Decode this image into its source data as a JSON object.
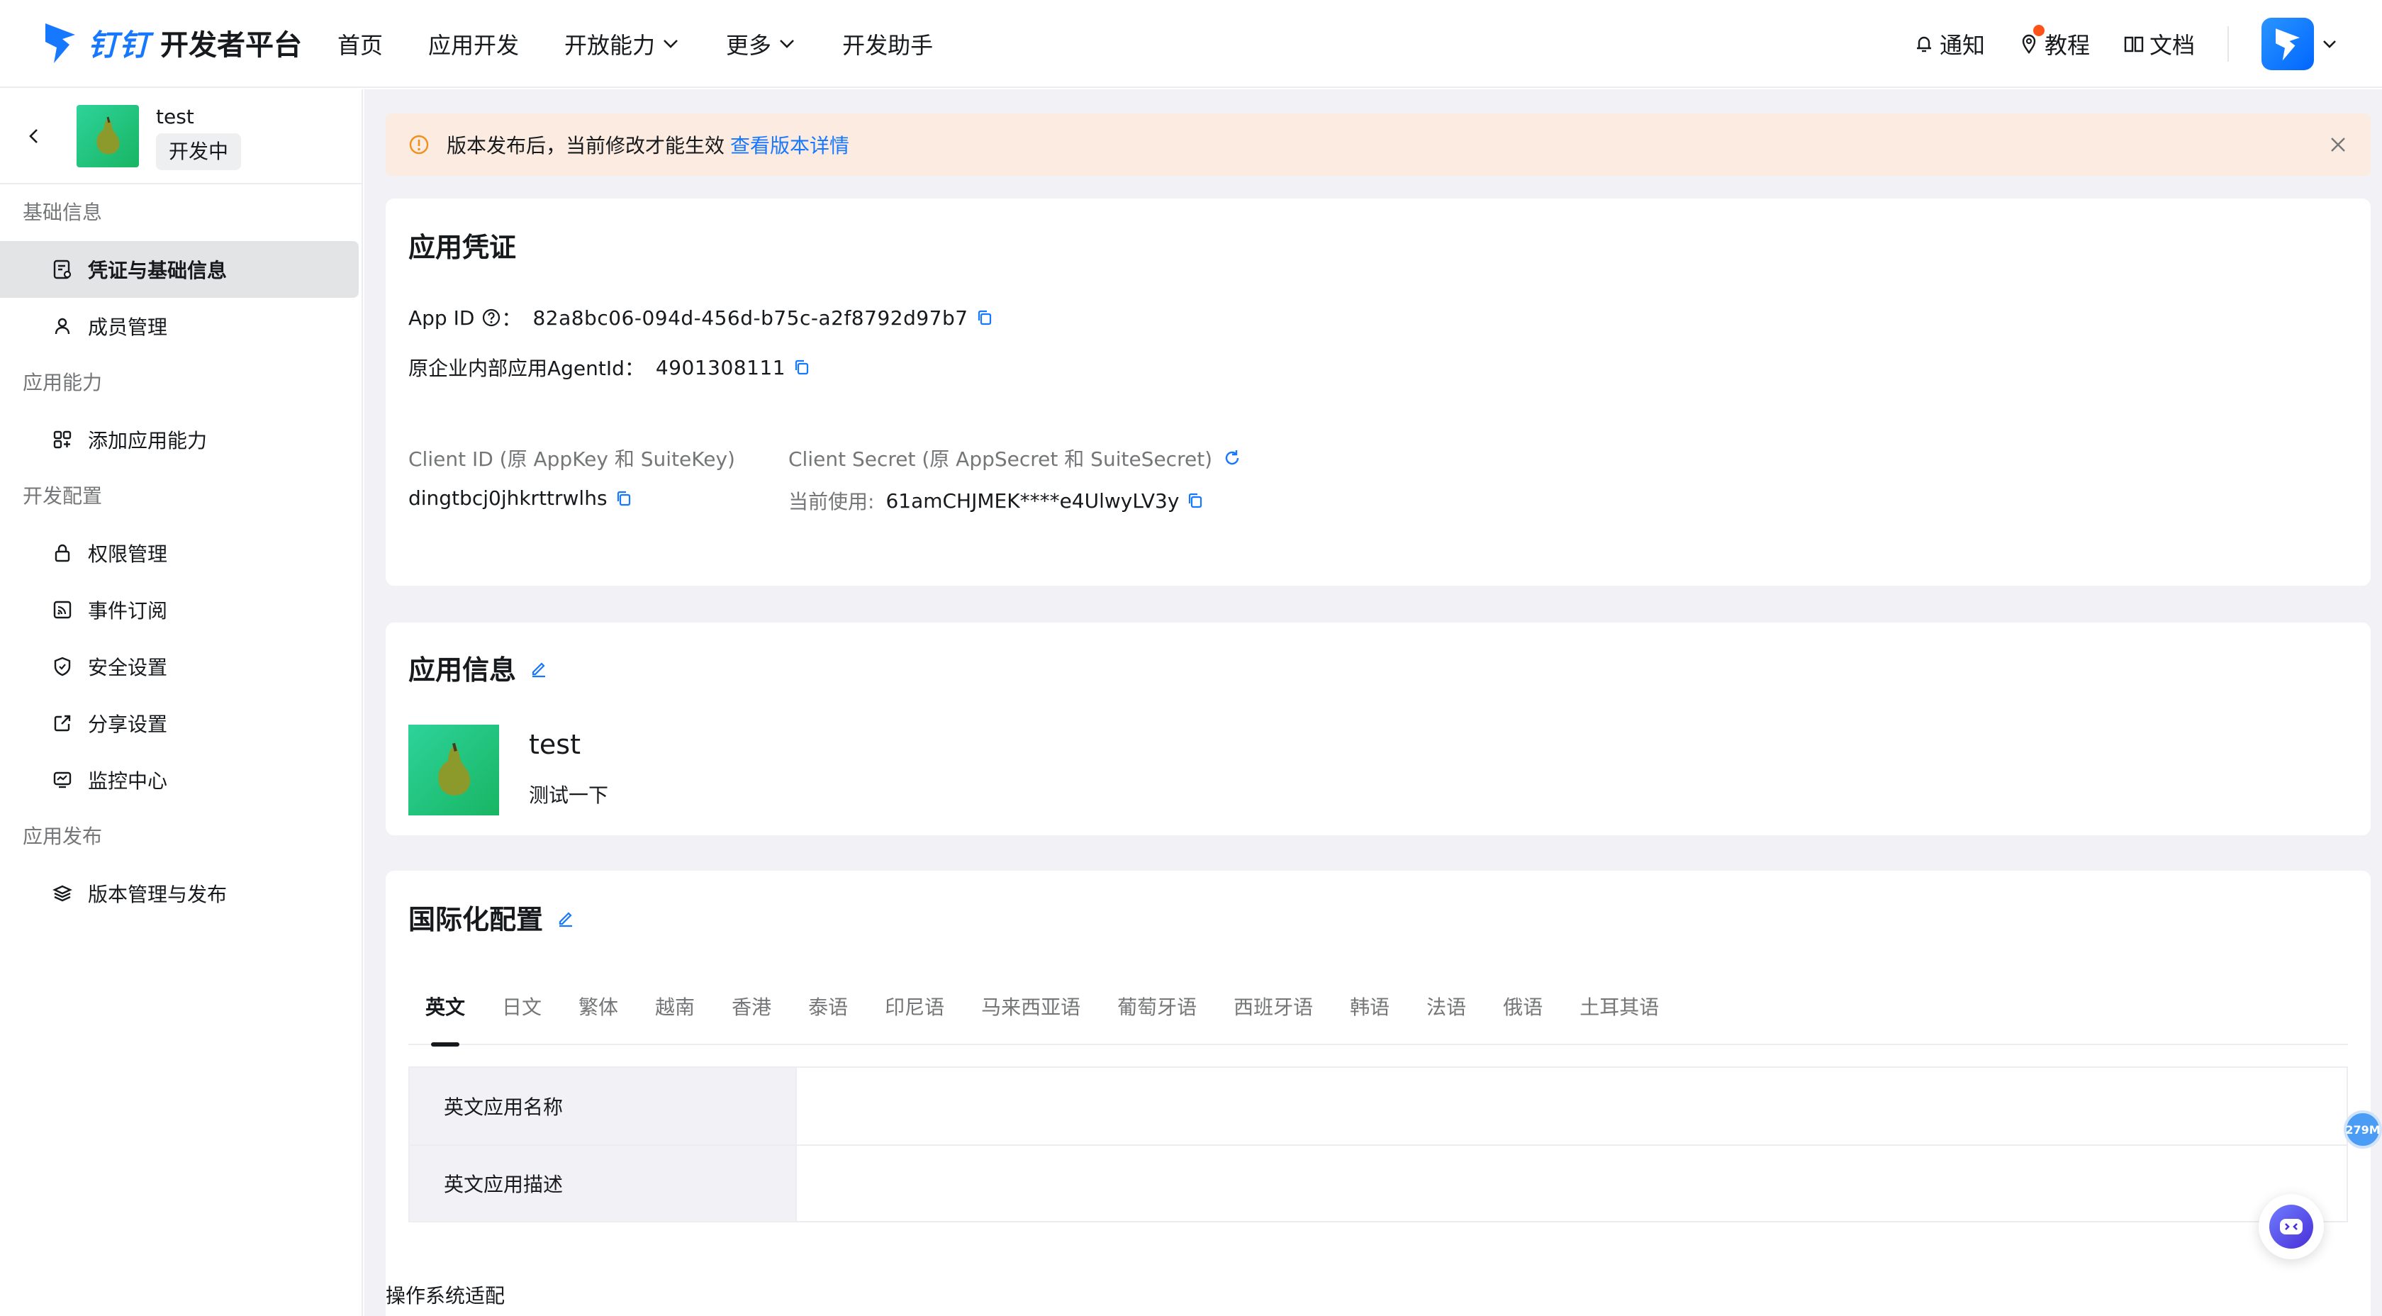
{
  "brand": {
    "logo_text": "钉钉",
    "subtitle": "开发者平台",
    "accent": "#1677ff"
  },
  "nav": {
    "items": [
      {
        "label": "首页",
        "dropdown": false
      },
      {
        "label": "应用开发",
        "dropdown": false
      },
      {
        "label": "开放能力",
        "dropdown": true
      },
      {
        "label": "更多",
        "dropdown": true
      },
      {
        "label": "开发助手",
        "dropdown": false
      }
    ]
  },
  "topright": {
    "notify": "通知",
    "tutorial": "教程",
    "docs": "文档"
  },
  "sidebar": {
    "app_name": "test",
    "app_status": "开发中",
    "groups": [
      {
        "title": "基础信息",
        "items": [
          {
            "label": "凭证与基础信息",
            "icon": "credential-icon",
            "active": true
          },
          {
            "label": "成员管理",
            "icon": "user-icon",
            "active": false
          }
        ]
      },
      {
        "title": "应用能力",
        "items": [
          {
            "label": "添加应用能力",
            "icon": "apps-add-icon",
            "active": false
          }
        ]
      },
      {
        "title": "开发配置",
        "items": [
          {
            "label": "权限管理",
            "icon": "lock-icon",
            "active": false
          },
          {
            "label": "事件订阅",
            "icon": "rss-icon",
            "active": false
          },
          {
            "label": "安全设置",
            "icon": "shield-icon",
            "active": false
          },
          {
            "label": "分享设置",
            "icon": "share-icon",
            "active": false
          },
          {
            "label": "监控中心",
            "icon": "monitor-icon",
            "active": false
          }
        ]
      },
      {
        "title": "应用发布",
        "items": [
          {
            "label": "版本管理与发布",
            "icon": "layers-icon",
            "active": false
          }
        ]
      }
    ]
  },
  "banner": {
    "text": "版本发布后，当前修改才能生效",
    "link": "查看版本详情"
  },
  "credentials": {
    "title": "应用凭证",
    "app_id_label": "App ID",
    "app_id_colon": "：",
    "app_id": "82a8bc06-094d-456d-b75c-a2f8792d97b7",
    "agent_label": "原企业内部应用AgentId：",
    "agent_id": "4901308111",
    "client_id_label": "Client ID (原 AppKey 和 SuiteKey)",
    "client_id": "dingtbcj0jhkrttrwlhs",
    "client_secret_label": "Client Secret (原 AppSecret 和 SuiteSecret)",
    "secret_current_label": "当前使用:",
    "client_secret": "61amCHJMEK****e4UlwyLV3y"
  },
  "app_info": {
    "title": "应用信息",
    "name": "test",
    "desc": "测试一下"
  },
  "i18n": {
    "title": "国际化配置",
    "tabs": [
      "英文",
      "日文",
      "繁体",
      "越南",
      "香港",
      "泰语",
      "印尼语",
      "马来西亚语",
      "葡萄牙语",
      "西班牙语",
      "韩语",
      "法语",
      "俄语",
      "土耳其语"
    ],
    "active_tab": "英文",
    "rows": [
      {
        "key": "英文应用名称",
        "value": ""
      },
      {
        "key": "英文应用描述",
        "value": ""
      }
    ]
  },
  "os_section_title": "操作系统适配",
  "float_badge": "279M"
}
